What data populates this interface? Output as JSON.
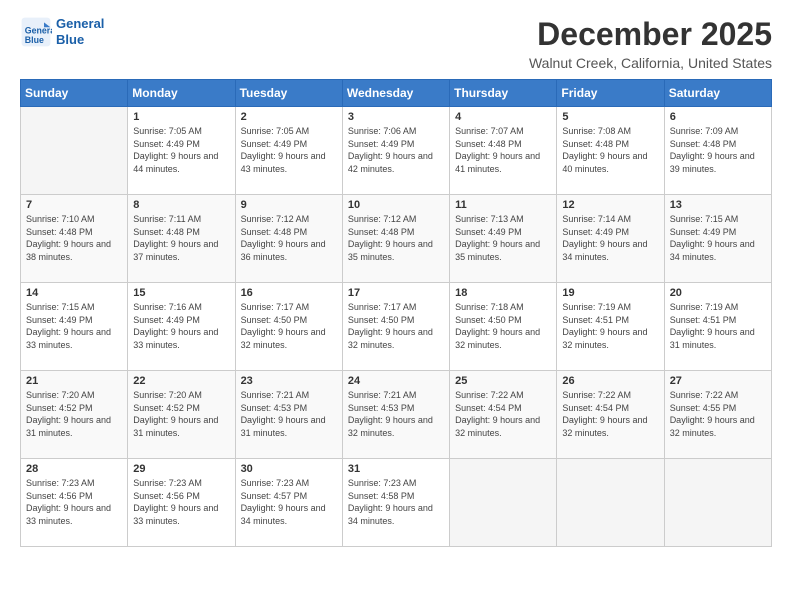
{
  "header": {
    "logo_line1": "General",
    "logo_line2": "Blue",
    "main_title": "December 2025",
    "subtitle": "Walnut Creek, California, United States"
  },
  "calendar": {
    "days_of_week": [
      "Sunday",
      "Monday",
      "Tuesday",
      "Wednesday",
      "Thursday",
      "Friday",
      "Saturday"
    ],
    "weeks": [
      [
        {
          "num": "",
          "empty": true
        },
        {
          "num": "1",
          "sunrise": "7:05 AM",
          "sunset": "4:49 PM",
          "daylight": "9 hours and 44 minutes."
        },
        {
          "num": "2",
          "sunrise": "7:05 AM",
          "sunset": "4:49 PM",
          "daylight": "9 hours and 43 minutes."
        },
        {
          "num": "3",
          "sunrise": "7:06 AM",
          "sunset": "4:49 PM",
          "daylight": "9 hours and 42 minutes."
        },
        {
          "num": "4",
          "sunrise": "7:07 AM",
          "sunset": "4:48 PM",
          "daylight": "9 hours and 41 minutes."
        },
        {
          "num": "5",
          "sunrise": "7:08 AM",
          "sunset": "4:48 PM",
          "daylight": "9 hours and 40 minutes."
        },
        {
          "num": "6",
          "sunrise": "7:09 AM",
          "sunset": "4:48 PM",
          "daylight": "9 hours and 39 minutes."
        }
      ],
      [
        {
          "num": "7",
          "sunrise": "7:10 AM",
          "sunset": "4:48 PM",
          "daylight": "9 hours and 38 minutes."
        },
        {
          "num": "8",
          "sunrise": "7:11 AM",
          "sunset": "4:48 PM",
          "daylight": "9 hours and 37 minutes."
        },
        {
          "num": "9",
          "sunrise": "7:12 AM",
          "sunset": "4:48 PM",
          "daylight": "9 hours and 36 minutes."
        },
        {
          "num": "10",
          "sunrise": "7:12 AM",
          "sunset": "4:48 PM",
          "daylight": "9 hours and 35 minutes."
        },
        {
          "num": "11",
          "sunrise": "7:13 AM",
          "sunset": "4:49 PM",
          "daylight": "9 hours and 35 minutes."
        },
        {
          "num": "12",
          "sunrise": "7:14 AM",
          "sunset": "4:49 PM",
          "daylight": "9 hours and 34 minutes."
        },
        {
          "num": "13",
          "sunrise": "7:15 AM",
          "sunset": "4:49 PM",
          "daylight": "9 hours and 34 minutes."
        }
      ],
      [
        {
          "num": "14",
          "sunrise": "7:15 AM",
          "sunset": "4:49 PM",
          "daylight": "9 hours and 33 minutes."
        },
        {
          "num": "15",
          "sunrise": "7:16 AM",
          "sunset": "4:49 PM",
          "daylight": "9 hours and 33 minutes."
        },
        {
          "num": "16",
          "sunrise": "7:17 AM",
          "sunset": "4:50 PM",
          "daylight": "9 hours and 32 minutes."
        },
        {
          "num": "17",
          "sunrise": "7:17 AM",
          "sunset": "4:50 PM",
          "daylight": "9 hours and 32 minutes."
        },
        {
          "num": "18",
          "sunrise": "7:18 AM",
          "sunset": "4:50 PM",
          "daylight": "9 hours and 32 minutes."
        },
        {
          "num": "19",
          "sunrise": "7:19 AM",
          "sunset": "4:51 PM",
          "daylight": "9 hours and 32 minutes."
        },
        {
          "num": "20",
          "sunrise": "7:19 AM",
          "sunset": "4:51 PM",
          "daylight": "9 hours and 31 minutes."
        }
      ],
      [
        {
          "num": "21",
          "sunrise": "7:20 AM",
          "sunset": "4:52 PM",
          "daylight": "9 hours and 31 minutes."
        },
        {
          "num": "22",
          "sunrise": "7:20 AM",
          "sunset": "4:52 PM",
          "daylight": "9 hours and 31 minutes."
        },
        {
          "num": "23",
          "sunrise": "7:21 AM",
          "sunset": "4:53 PM",
          "daylight": "9 hours and 31 minutes."
        },
        {
          "num": "24",
          "sunrise": "7:21 AM",
          "sunset": "4:53 PM",
          "daylight": "9 hours and 32 minutes."
        },
        {
          "num": "25",
          "sunrise": "7:22 AM",
          "sunset": "4:54 PM",
          "daylight": "9 hours and 32 minutes."
        },
        {
          "num": "26",
          "sunrise": "7:22 AM",
          "sunset": "4:54 PM",
          "daylight": "9 hours and 32 minutes."
        },
        {
          "num": "27",
          "sunrise": "7:22 AM",
          "sunset": "4:55 PM",
          "daylight": "9 hours and 32 minutes."
        }
      ],
      [
        {
          "num": "28",
          "sunrise": "7:23 AM",
          "sunset": "4:56 PM",
          "daylight": "9 hours and 33 minutes."
        },
        {
          "num": "29",
          "sunrise": "7:23 AM",
          "sunset": "4:56 PM",
          "daylight": "9 hours and 33 minutes."
        },
        {
          "num": "30",
          "sunrise": "7:23 AM",
          "sunset": "4:57 PM",
          "daylight": "9 hours and 34 minutes."
        },
        {
          "num": "31",
          "sunrise": "7:23 AM",
          "sunset": "4:58 PM",
          "daylight": "9 hours and 34 minutes."
        },
        {
          "num": "",
          "empty": true
        },
        {
          "num": "",
          "empty": true
        },
        {
          "num": "",
          "empty": true
        }
      ]
    ]
  }
}
